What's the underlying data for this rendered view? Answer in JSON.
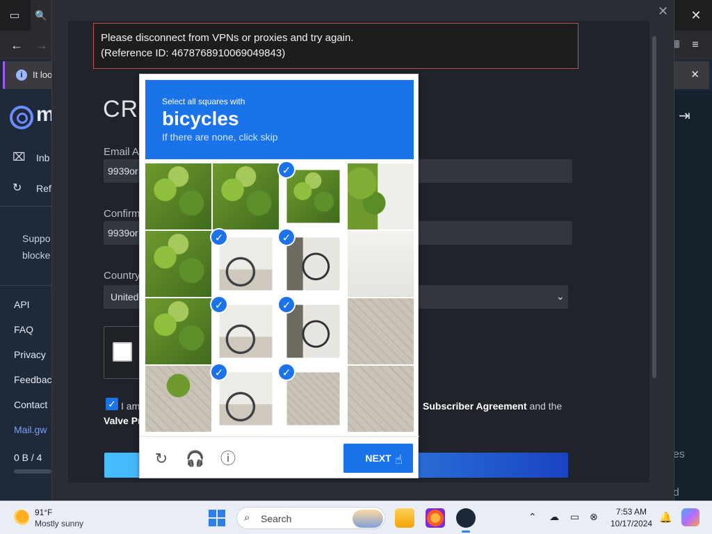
{
  "browser": {
    "info_bar_text": "It loo",
    "ext_icon": "puzzle-icon"
  },
  "sidebar": {
    "logo_text": "m",
    "items": [
      {
        "label": "Inb",
        "icon": "inbox-icon"
      },
      {
        "label": "Ref",
        "icon": "refresh-icon"
      }
    ],
    "support_line1": "Suppo",
    "support_line2": "blocke",
    "links": [
      "API",
      "FAQ",
      "Privacy",
      "Feedbac",
      "Contact"
    ],
    "domain_link": "Mail.gw",
    "storage": "0 B  /  4"
  },
  "right_col": {
    "text1": "es",
    "text2": "d"
  },
  "modal": {
    "error_line1": "Please disconnect from VPNs or proxies and try again.",
    "error_line2": "(Reference ID: 4678768910069049843)",
    "title": "CRI",
    "email_label": "Email Ac",
    "email_value": "9939or",
    "confirm_label": "Confirm",
    "confirm_value": "9939or",
    "country_label": "Country",
    "country_value": "United",
    "agree_prefix": "I am",
    "agree_ssa": "Subscriber Agreement",
    "agree_and": " and the",
    "agree_line2": "Valve Pr"
  },
  "captcha": {
    "header_small": "Select all squares with",
    "header_target": "bicycles",
    "header_hint": "If there are none, click skip",
    "next_label": "NEXT",
    "tiles": [
      {
        "img": "leaves",
        "selected": false
      },
      {
        "img": "leaves",
        "selected": false
      },
      {
        "img": "leaves",
        "selected": true
      },
      {
        "img": "wall-leaves",
        "selected": false
      },
      {
        "img": "leaves",
        "selected": false
      },
      {
        "img": "bike",
        "selected": true
      },
      {
        "img": "bike2",
        "selected": true
      },
      {
        "img": "wall",
        "selected": false
      },
      {
        "img": "leaves",
        "selected": false
      },
      {
        "img": "bike",
        "selected": true
      },
      {
        "img": "bike2",
        "selected": true
      },
      {
        "img": "pave",
        "selected": false
      },
      {
        "img": "pave-leaves",
        "selected": false
      },
      {
        "img": "bike",
        "selected": true
      },
      {
        "img": "pave",
        "selected": true
      },
      {
        "img": "pave",
        "selected": false
      }
    ]
  },
  "taskbar": {
    "temp": "91°F",
    "condition": "Mostly sunny",
    "search_placeholder": "Search",
    "time": "7:53 AM",
    "date": "10/17/2024",
    "accent": "#2d7ee8"
  }
}
